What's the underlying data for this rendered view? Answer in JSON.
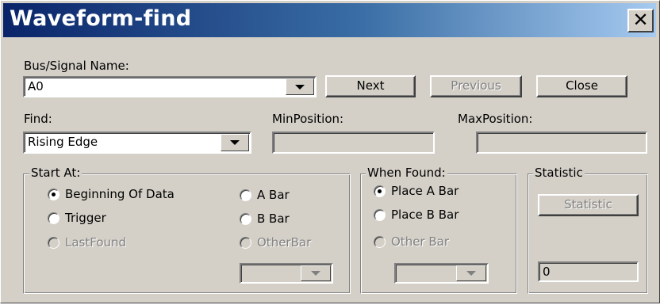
{
  "window": {
    "title": "Waveform-find"
  },
  "bus_signal": {
    "label": "Bus/Signal Name:",
    "value": "A0"
  },
  "buttons": {
    "next": "Next",
    "previous": "Previous",
    "close": "Close"
  },
  "find": {
    "label": "Find:",
    "value": "Rising Edge"
  },
  "min_position": {
    "label": "MinPosition:",
    "value": ""
  },
  "max_position": {
    "label": "MaxPosition:",
    "value": ""
  },
  "start_at": {
    "title": "Start At:",
    "options": [
      "Beginning Of Data",
      "Trigger",
      "LastFound",
      "A Bar",
      "B Bar",
      "OtherBar"
    ],
    "selected": "Beginning Of Data",
    "other_bar_value": ""
  },
  "when_found": {
    "title": "When Found:",
    "options": [
      "Place A Bar",
      "Place B Bar",
      "Other Bar"
    ],
    "selected": "Place A Bar",
    "other_bar_value": ""
  },
  "statistic": {
    "title": "Statistic",
    "button_label": "Statistic",
    "value": "0"
  }
}
